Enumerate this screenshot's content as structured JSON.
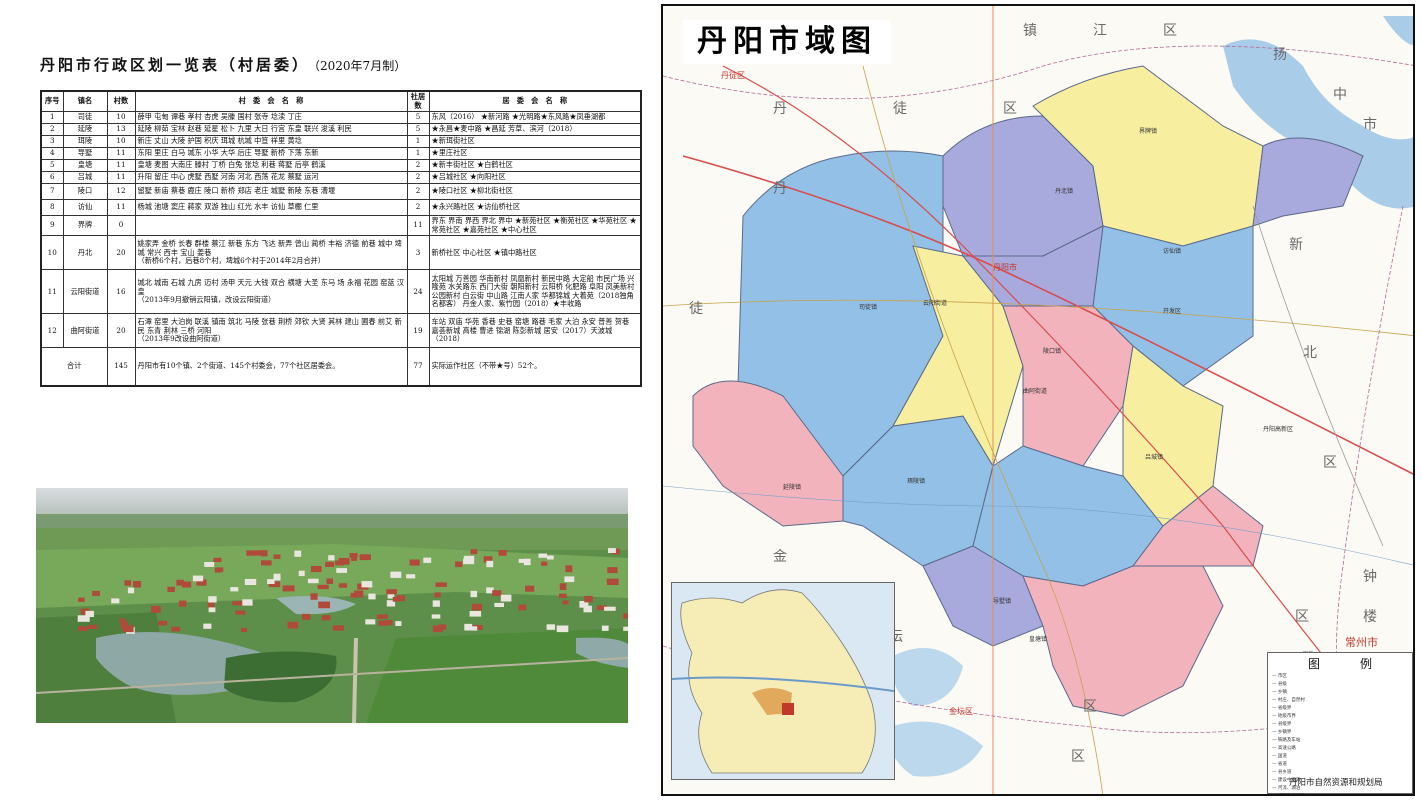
{
  "doc": {
    "title": "丹阳市行政区划一览表（村居委）",
    "date": "（2020年7月制）"
  },
  "table": {
    "headers": [
      "序号",
      "镇名",
      "村数",
      "村　委　会　名　称",
      "社居数",
      "居　委　会　名　称"
    ],
    "rows": [
      [
        "1",
        "司徒",
        "10",
        "薛甲 屯甸 谭巷 孝村 杏虎 吴滕 国村 张寺 埝渎 丁庄",
        "5",
        "东风（2016） ★新河路 ★光明路★东风路★凤垂湖都"
      ],
      [
        "2",
        "延陵",
        "13",
        "延陵 柳茹 宝林 赵巷 延星 松卜 九里 大日 行宫 东皇 联兴 浚溪 利民",
        "5",
        "★永昌★麦中路 ★昌延 芳草、滨河（2018）"
      ],
      [
        "3",
        "珥陵",
        "10",
        "新庄 丈山 大陵 护国 积庆 珥城 杭城 中笪 祥里 黄埝",
        "1",
        "★新珥街社区"
      ],
      [
        "4",
        "导墅",
        "11",
        "东阳 里庄 白马 城东 小华 大华 后庄 导墅 新桥 下荡 东新",
        "1",
        "★里庄社区"
      ],
      [
        "5",
        "皇塘",
        "11",
        "皇塘 麦图 大南庄 滕村 丁桥 白兔 张埝 利巷 蒋墅 后亭 鹤溪",
        "2",
        "★新丰街社区 ★白鹤社区"
      ],
      [
        "6",
        "吕城",
        "11",
        "升阳 留庄 中心 虎墅 西墅 河南 河北 西荡 花龙 蔡墅 运河",
        "2",
        "★吕城社区 ★向阳社区"
      ],
      [
        "7",
        "陵口",
        "12",
        "留墅 新庙 蔡巷 鹿庄 陵口 新桥 郑店 老庄 城墅 新陵 东巷 漕堰",
        "2",
        "★陵口社区 ★柳北街社区"
      ],
      [
        "8",
        "访仙",
        "11",
        "杨城 池塘 窦庄 蔣家 双游 独山 红光 水丰 访仙 草棚 仁里",
        "2",
        "★永兴路社区 ★访仙桥社区"
      ],
      [
        "9",
        "界牌",
        "0",
        "",
        "11",
        "界东 界南 界西 界北 界中 ★新苑社区 ★衡苑社区 ★华苑社区 ★常苑社区 ★嘉苑社区 ★中心社区"
      ],
      [
        "10",
        "丹北",
        "20",
        "姚家弄 金桥 长春 群楼 蔡江 新巷 东方 飞达 新弄 曾山 蔺桥 丰裕 济德 前巷 城中 埤城 常兴 西丰 宝山 姜巷",
        "3",
        "新桥社区 中心社区 ★镇中路社区"
      ],
      [
        "11",
        "云阳街道",
        "16",
        "城北 城南 石城 九房 迈村 汤甲 天元 大钱 双合 横塘 大圣 东马 场 永福 花园 窑蓝 汉皇",
        "24",
        "太阳城 万善园 华南新村 凤凰新村 新民中路 大定船 市民广场 兴隆苑 水关路东 西门大街 朝阳新村 云阳桥 化肥路 阜阳 凤美新村 公园新村 白云街 中山路 江南人家 华都锦城 大着苑（2018独角名都客） 丹金人家、紫竹园（2018）★丰收路"
      ],
      [
        "12",
        "曲阿街道",
        "20",
        "石潭 窑里 大泊岗 联溪 镇南 筑北 马陵 张巷 荆桥 郊钦 大贤 其林 建山 圃春 前艾 新民 东青 荆林 三桥 河阳",
        "19",
        "车站 双庙 华苑 香巷 史巷 窑塘 路巷 毛家 大泊 永安 普善 贺巷 嘉荟新城 高楼 曹进 锦湖 陈彭新城 居安（2017）天波城（2018）"
      ]
    ],
    "notes": {
      "10": "（新桥6个村，后巷8个村，埤城6个村于2014年2月合并）",
      "11": "（2013年9月撤销云阳镇，改设云阳街道）",
      "12": "（2013年9改设曲阿街道）"
    },
    "total": [
      "合计",
      "145",
      "丹阳市有10个镇、2个街道、145个村委会，77个社区居委会。",
      "77",
      "实际运作社区（不带★号）52个。"
    ]
  },
  "map": {
    "title": "丹阳市域图",
    "region_labels": [
      "镇",
      "江",
      "区",
      "扬",
      "中",
      "市",
      "丹",
      "徒",
      "区",
      "丹",
      "徒",
      "新",
      "北",
      "区",
      "金",
      "坛",
      "区",
      "钟",
      "楼",
      "区",
      "武",
      "进",
      "区"
    ],
    "city_label": "丹阳市",
    "neighbor_city": "常州市",
    "dantu_label": "丹徒区",
    "jintan_label": "金坛区",
    "town_labels": [
      "司徒镇",
      "延陵镇",
      "珥陵镇",
      "导墅镇",
      "皇塘镇",
      "吕城镇",
      "陵口镇",
      "访仙镇",
      "界牌镇",
      "丹北镇",
      "云阳街道",
      "曲阿街道",
      "开发区",
      "丹阳高新区"
    ],
    "legend_title": "图例",
    "legend_items": [
      "市区",
      "县级",
      "乡镇",
      "村庄、自然村",
      "省级界",
      "地级市界",
      "县级界",
      "乡镇界",
      "铁路及车站",
      "高速公路",
      "国道",
      "省道",
      "县乡道",
      "建设中道路",
      "河流、湖泊",
      "城区及规划区"
    ],
    "footer": "丹阳市自然资源和规划局"
  },
  "colors": {
    "blue": "#93c0e6",
    "yellow": "#f7eea0",
    "pink": "#f2b3bd",
    "purple": "#a8a9dc",
    "water": "#a9cde8",
    "road": "#d94c4c"
  }
}
